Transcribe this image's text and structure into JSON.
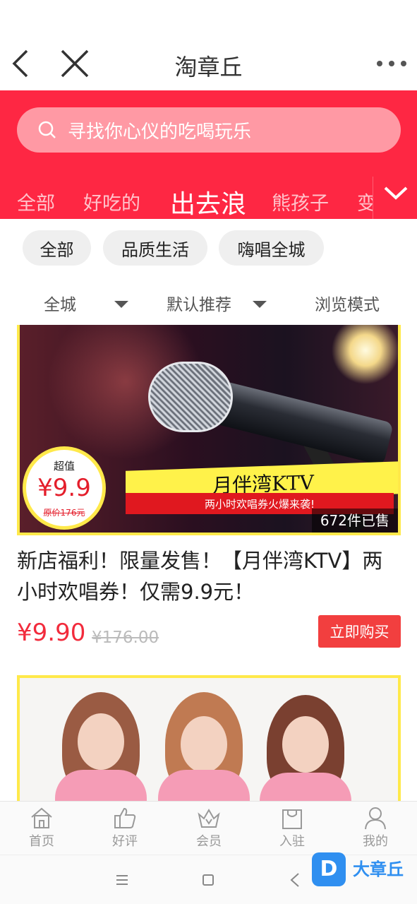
{
  "header": {
    "title": "淘章丘"
  },
  "search": {
    "placeholder": "寻找你心仪的吃喝玩乐"
  },
  "categories": [
    {
      "label": "全部"
    },
    {
      "label": "好吃的"
    },
    {
      "label": "出去浪",
      "active": true
    },
    {
      "label": "熊孩子"
    },
    {
      "label": "变"
    }
  ],
  "chips": [
    {
      "label": "全部"
    },
    {
      "label": "品质生活"
    },
    {
      "label": "嗨唱全城"
    }
  ],
  "filters": {
    "area": "全城",
    "sort": "默认推荐",
    "mode": "浏览模式"
  },
  "product1": {
    "banner_title": "月伴湾KTV",
    "banner_slogan": "两小时欢唱券火爆来袭!",
    "badge_top": "超值",
    "badge_price": "¥9.9",
    "badge_original": "原价176元",
    "sold": "672件已售",
    "title": "新店福利！限量发售！【月伴湾KTV】两小时欢唱券！仅需9.9元！",
    "price": "¥9.90",
    "original_price": "¥176.00",
    "buy_label": "立即购买"
  },
  "tabbar": [
    {
      "label": "首页",
      "icon": "home-icon"
    },
    {
      "label": "好评",
      "icon": "thumbs-up-icon"
    },
    {
      "label": "会员",
      "icon": "crown-icon"
    },
    {
      "label": "入驻",
      "icon": "shopping-bag-icon"
    },
    {
      "label": "我的",
      "icon": "user-icon"
    }
  ],
  "watermark": {
    "mark": "D",
    "text": "大章丘"
  },
  "colors": {
    "brand": "#fe2743",
    "price": "#f22b3c",
    "buy": "#f23f3f"
  }
}
